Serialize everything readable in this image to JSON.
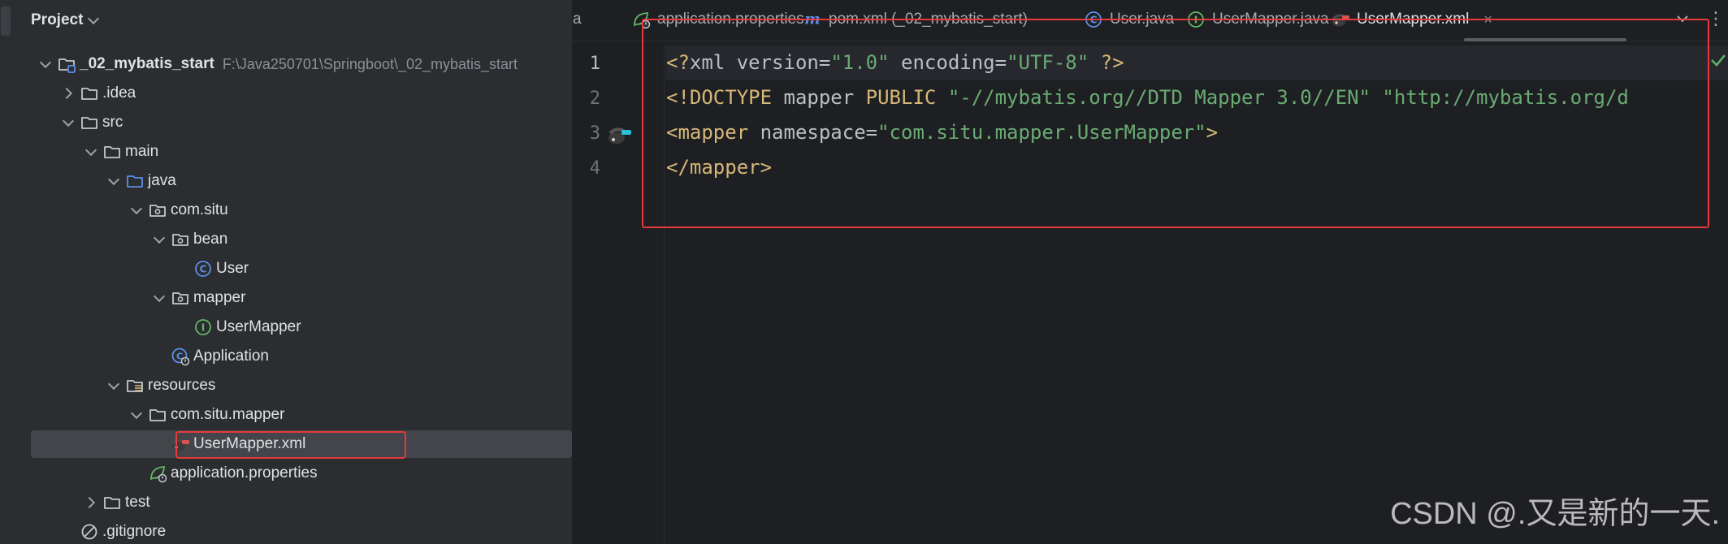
{
  "project_panel": {
    "title": "Project",
    "tree": [
      {
        "label": "_02_mybatis_start",
        "path": "F:\\Java250701\\Springboot\\_02_mybatis_start",
        "icon": "module-folder-icon",
        "depth": 0,
        "arrow": "open",
        "root": true
      },
      {
        "label": ".idea",
        "icon": "folder-icon",
        "depth": 1,
        "arrow": "closed"
      },
      {
        "label": "src",
        "icon": "folder-icon",
        "depth": 1,
        "arrow": "open"
      },
      {
        "label": "main",
        "icon": "folder-icon",
        "depth": 2,
        "arrow": "open"
      },
      {
        "label": "java",
        "icon": "source-folder-icon",
        "depth": 3,
        "arrow": "open"
      },
      {
        "label": "com.situ",
        "icon": "package-icon",
        "depth": 4,
        "arrow": "open"
      },
      {
        "label": "bean",
        "icon": "package-icon",
        "depth": 5,
        "arrow": "open"
      },
      {
        "label": "User",
        "icon": "class-icon",
        "depth": 6,
        "arrow": "none"
      },
      {
        "label": "mapper",
        "icon": "package-icon",
        "depth": 5,
        "arrow": "open"
      },
      {
        "label": "UserMapper",
        "icon": "interface-icon",
        "depth": 6,
        "arrow": "none"
      },
      {
        "label": "Application",
        "icon": "spring-app-class-icon",
        "depth": 5,
        "arrow": "none"
      },
      {
        "label": "resources",
        "icon": "resources-folder-icon",
        "depth": 3,
        "arrow": "open"
      },
      {
        "label": "com.situ.mapper",
        "icon": "folder-icon",
        "depth": 4,
        "arrow": "open"
      },
      {
        "label": "UserMapper.xml",
        "icon": "mybatis-xml-icon",
        "depth": 5,
        "arrow": "none",
        "selected": true
      },
      {
        "label": "application.properties",
        "icon": "spring-properties-icon",
        "depth": 4,
        "arrow": "none"
      },
      {
        "label": "test",
        "icon": "folder-icon",
        "depth": 2,
        "arrow": "closed"
      },
      {
        "label": ".gitignore",
        "icon": "gitignore-icon",
        "depth": 1,
        "arrow": "none"
      }
    ]
  },
  "tabs": [
    {
      "label": "a",
      "icon": "",
      "active": false
    },
    {
      "label": "application.properties",
      "icon": "spring-properties-icon",
      "active": false
    },
    {
      "label": "pom.xml (_02_mybatis_start)",
      "icon": "maven-icon",
      "active": false
    },
    {
      "label": "User.java",
      "icon": "class-icon",
      "active": false
    },
    {
      "label": "UserMapper.java",
      "icon": "interface-icon",
      "active": false
    },
    {
      "label": "UserMapper.xml",
      "icon": "mybatis-xml-icon",
      "active": true,
      "close": "×"
    }
  ],
  "editor": {
    "line_numbers": [
      "1",
      "2",
      "3",
      "4"
    ],
    "lines": [
      [
        [
          "tag",
          "<?"
        ],
        [
          "plain",
          "xml "
        ],
        [
          "attr",
          "version"
        ],
        [
          "plain",
          "="
        ],
        [
          "str",
          "\"1.0\""
        ],
        [
          "plain",
          " "
        ],
        [
          "attr",
          "encoding"
        ],
        [
          "plain",
          "="
        ],
        [
          "str",
          "\"UTF-8\""
        ],
        [
          "plain",
          " "
        ],
        [
          "tag",
          "?>"
        ]
      ],
      [
        [
          "tag",
          "<!DOCTYPE "
        ],
        [
          "plain",
          "mapper "
        ],
        [
          "tag",
          "PUBLIC "
        ],
        [
          "str",
          "\"-//mybatis.org//DTD Mapper 3.0//EN\" \"http://mybatis.org/d"
        ]
      ],
      [
        [
          "tag",
          "<mapper "
        ],
        [
          "attr",
          "namespace"
        ],
        [
          "plain",
          "="
        ],
        [
          "str",
          "\"com.situ.mapper.UserMapper\""
        ],
        [
          "tag",
          ">"
        ]
      ],
      [
        [
          "tag",
          "</mapper>"
        ]
      ]
    ]
  },
  "colors": {
    "highlight_box": "#e5393b",
    "xml_tag": "#d5b778",
    "xml_string": "#6aab73"
  },
  "watermark": "CSDN @.又是新的一天."
}
